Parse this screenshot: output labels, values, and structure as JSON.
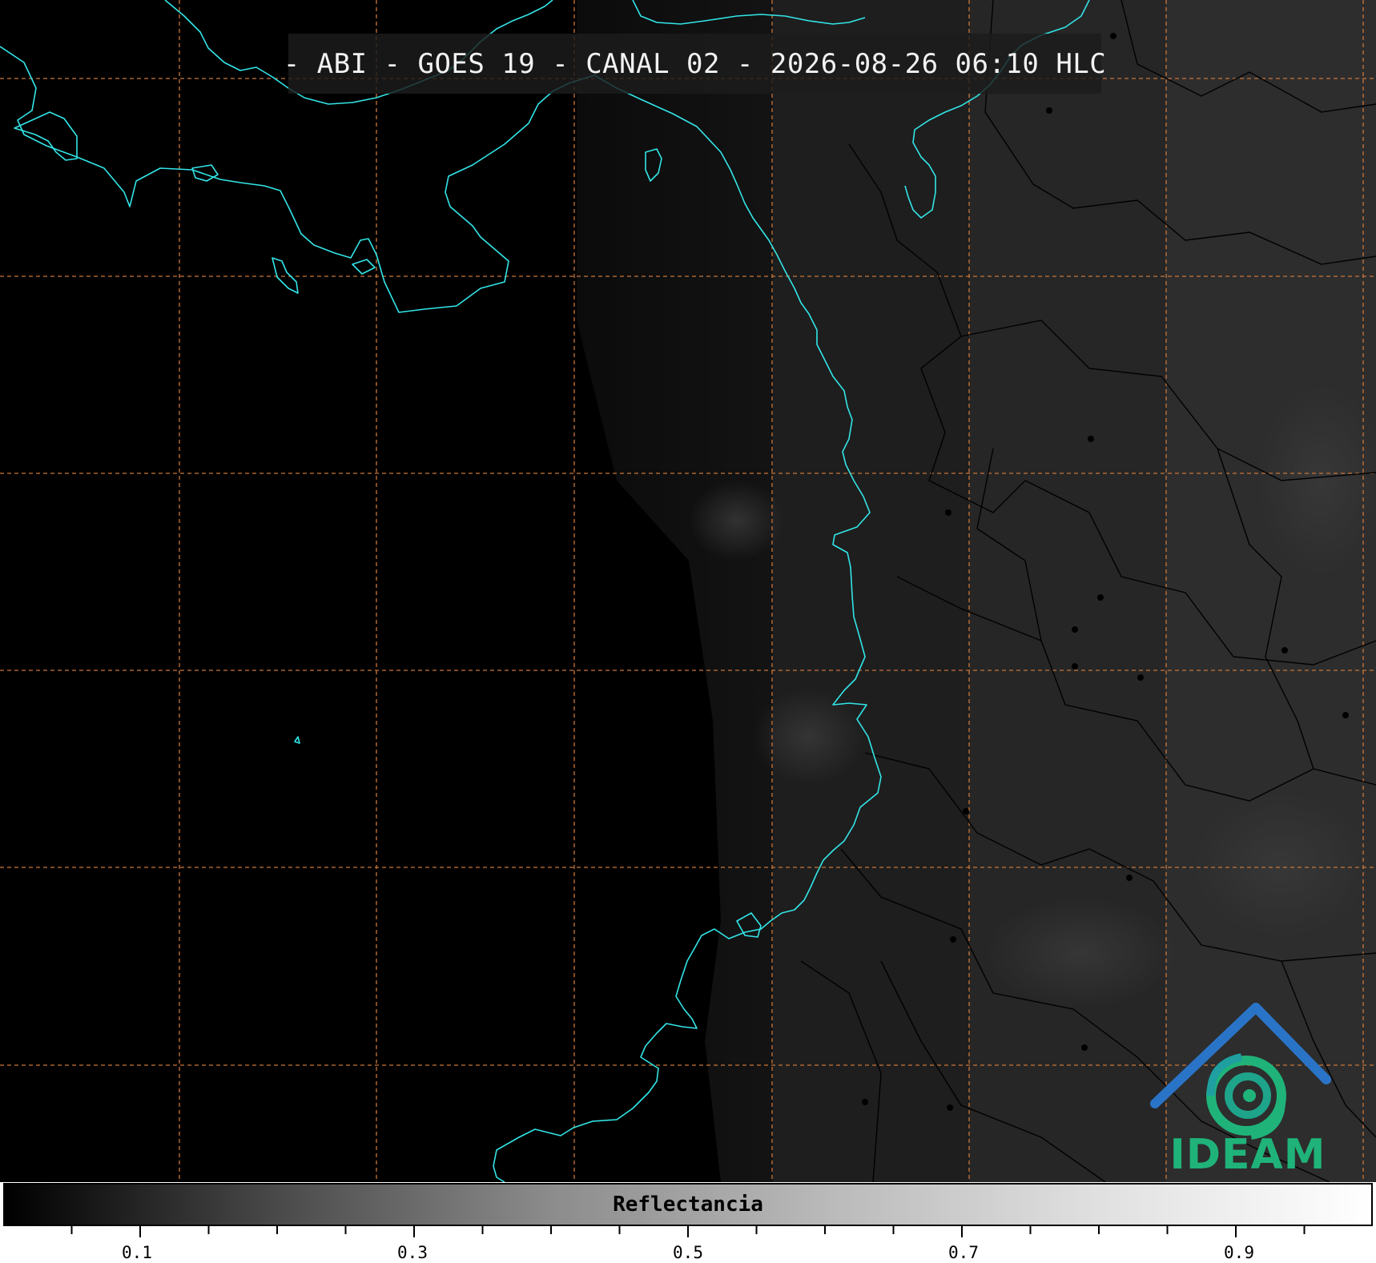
{
  "title": "- ABI - GOES 19 - CANAL 02 - 2026-08-26 06:10 HLC",
  "colorbar": {
    "label": "Reflectancia",
    "ticks": [
      "0.1",
      "0.3",
      "0.5",
      "0.7",
      "0.9"
    ]
  },
  "logo": {
    "text": "IDEAM"
  },
  "colors": {
    "coastline": "#33e5e8",
    "graticule": "#c8763a",
    "borders": "#000000",
    "logo_blue": "#2a74c7",
    "logo_green": "#1fb37a"
  }
}
